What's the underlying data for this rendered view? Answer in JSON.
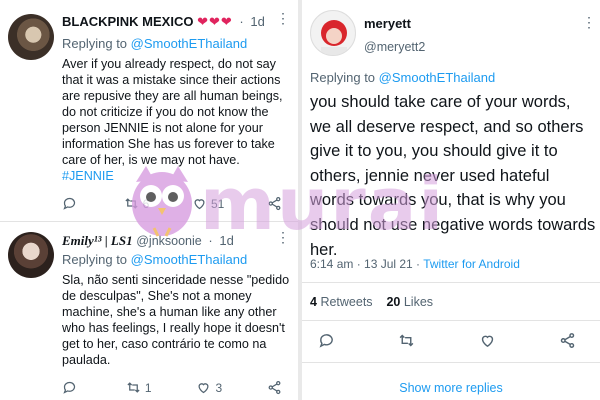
{
  "tweets": [
    {
      "display_name": "BLACKPINK MEXICO",
      "badge": "❤️❤️❤️",
      "time": "1d",
      "replying_prefix": "Replying to ",
      "replying_handle": "@SmoothEThailand",
      "text": "Aver if you already respect, do not say that it was a mistake since their actions are repusive they are all human beings, do not criticize if you do not know the person JENNIE  is not alone for your information She has us forever to take care of her, is we may not have.",
      "hashtag": "#JENNIE",
      "actions": {
        "reply": "",
        "retweet": "6",
        "like": "51",
        "share": ""
      }
    },
    {
      "display_name": "Emily¹³ | LS1",
      "handle": "@jnksoonie",
      "time": "1d",
      "replying_prefix": "Replying to ",
      "replying_handle": "@SmoothEThailand",
      "text": "Sla, não senti sinceridade nesse \"pedido de desculpas\", She's not a money machine, she's a human like any other who has feelings, I really hope it doesn't get to her, caso contrário te como na paulada.",
      "actions": {
        "reply": "",
        "retweet": "1",
        "like": "3",
        "share": ""
      }
    }
  ],
  "main_tweet": {
    "display_name": "meryett",
    "handle": "@meryett2",
    "replying_prefix": "Replying to ",
    "replying_handle": "@SmoothEThailand",
    "text": "you should take care of your words, we all deserve respect, and so others give it to you, you should give it to others, jennie never used hateful words towards you, that is why you should not use negative words towards her.",
    "timestamp": "6:14 am · 13 Jul 21 · ",
    "source": "Twitter for Android",
    "retweets_count": "4",
    "retweets_label": "Retweets",
    "likes_count": "20",
    "likes_label": "Likes"
  },
  "show_more": "Show more replies",
  "watermark": "murai",
  "colors": {
    "link": "#1d9bf0",
    "text": "#0f1419",
    "muted": "#536471",
    "heart": "#e0245e"
  }
}
